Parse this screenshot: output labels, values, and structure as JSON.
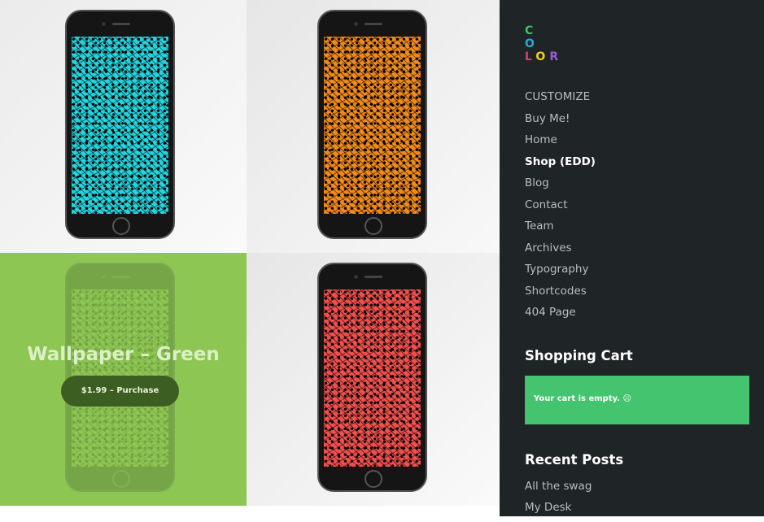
{
  "products": [
    {
      "name": "",
      "screen_color": "#25d3dc"
    },
    {
      "name": "",
      "screen_color": "#f08a1c"
    },
    {
      "name": "Wallpaper – Green",
      "price_button": "$1.99 – Purchase",
      "screen_color": "#8dc653",
      "hovered": true
    },
    {
      "name": "",
      "screen_color": "#f0504d"
    }
  ],
  "logo": {
    "letters": [
      "C",
      "O",
      "L",
      "O",
      "R"
    ],
    "colors": [
      "#3cc26b",
      "#2aa8d8",
      "#d63a78",
      "#f2d21c",
      "#9a5ae0"
    ]
  },
  "nav": {
    "items": [
      "CUSTOMIZE",
      "Buy Me!",
      "Home",
      "Shop (EDD)",
      "Blog",
      "Contact",
      "Team",
      "Archives",
      "Typography",
      "Shortcodes",
      "404 Page"
    ],
    "active": "Shop (EDD)"
  },
  "cart": {
    "title": "Shopping Cart",
    "empty_text": "Your cart is empty. ☹",
    "color": "#44c46e"
  },
  "recent": {
    "title": "Recent Posts",
    "items": [
      "All the swag",
      "My Desk"
    ]
  }
}
